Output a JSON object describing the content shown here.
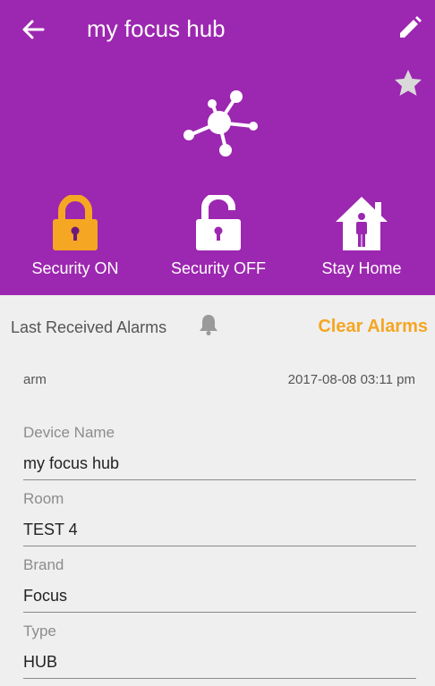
{
  "header": {
    "title": "my focus hub",
    "actions": [
      {
        "label": "Security ON"
      },
      {
        "label": "Security OFF"
      },
      {
        "label": "Stay Home"
      }
    ]
  },
  "alarms": {
    "title": "Last Received Alarms",
    "clear_label": "Clear Alarms",
    "items": [
      {
        "name": "arm",
        "time": "2017-08-08 03:11 pm"
      }
    ]
  },
  "details": [
    {
      "label": "Device Name",
      "value": "my focus hub"
    },
    {
      "label": "Room",
      "value": "TEST 4"
    },
    {
      "label": "Brand",
      "value": "Focus"
    },
    {
      "label": "Type",
      "value": "HUB"
    }
  ],
  "colors": {
    "header": "#9c27b0",
    "accent": "#f5a623",
    "background": "#efefef"
  }
}
